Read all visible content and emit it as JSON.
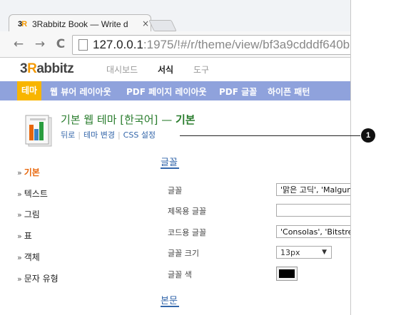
{
  "browser": {
    "tab_title": "3Rabbitz Book — Write d",
    "tab_close": "×",
    "url_host": "127.0.0.1",
    "url_path": ":1975/!#/r/theme/view/bf3a9cdddf640b",
    "back_glyph": "←",
    "forward_glyph": "→",
    "reload_glyph": "C"
  },
  "app": {
    "logo_prefix": "3",
    "logo_r": "R",
    "logo_rest": "abbitz",
    "topnav": [
      "대시보드",
      "서식",
      "도구"
    ],
    "menu": [
      "테마",
      "웹 뷰어 레이아웃",
      "PDF 페이지 레이아웃",
      "PDF 글꼴",
      "하이픈 패턴"
    ]
  },
  "theme": {
    "title": "기본 웹 테마 [한국어]",
    "dash": " — ",
    "subtitle": "기본",
    "actions": [
      "뒤로",
      "테마 변경",
      "CSS 설정"
    ]
  },
  "sidenav": [
    "기본",
    "텍스트",
    "그림",
    "표",
    "객체",
    "문자 유형"
  ],
  "sections": {
    "font": "글꼴",
    "body": "본문"
  },
  "font_rows": {
    "font_label": "글꼴",
    "font_value": "'맑은 고딕', 'Malgun",
    "title_font_label": "제목용 글꼴",
    "title_font_value": "",
    "code_font_label": "코드용 글꼴",
    "code_font_value": "'Consolas', 'Bitstre",
    "size_label": "글꼴 크기",
    "size_value": "13px",
    "color_label": "글꼴 색",
    "color_value": "#000000"
  },
  "callout": "1"
}
